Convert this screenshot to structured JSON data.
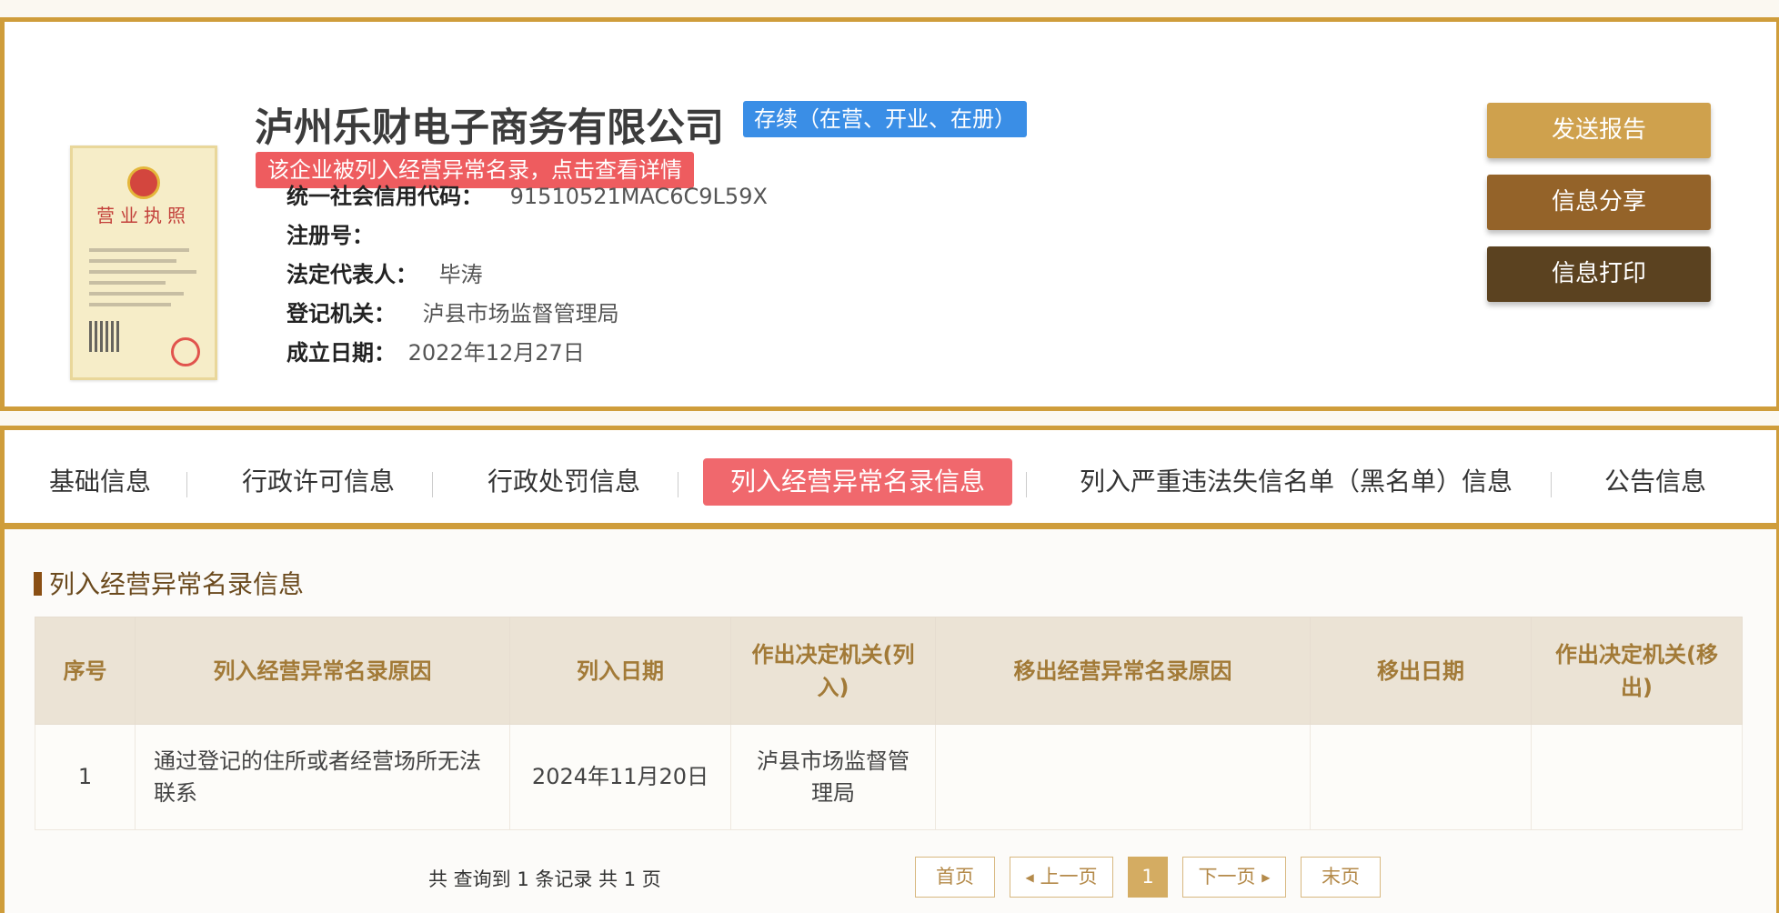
{
  "company": {
    "name": "泸州乐财电子商务有限公司",
    "status": "存续（在营、开业、在册）",
    "abnormal_notice": "该企业被列入经营异常名录，点击查看详情",
    "license_title": "营业执照",
    "fields": [
      {
        "label": "统一社会信用代码：",
        "value": "91510521MAC6C9L59X"
      },
      {
        "label": "注册号：",
        "value": ""
      },
      {
        "label": "法定代表人：",
        "value": "毕涛"
      },
      {
        "label": "登记机关：",
        "value": "泸县市场监督管理局"
      },
      {
        "label": "成立日期：",
        "value": "2022年12月27日"
      }
    ]
  },
  "actions": {
    "send_report": "发送报告",
    "share": "信息分享",
    "print": "信息打印"
  },
  "tabs": [
    {
      "label": "基础信息"
    },
    {
      "label": "行政许可信息"
    },
    {
      "label": "行政处罚信息"
    },
    {
      "label": "列入经营异常名录信息"
    },
    {
      "label": "列入严重违法失信名单（黑名单）信息"
    },
    {
      "label": "公告信息"
    }
  ],
  "section": {
    "title": "列入经营异常名录信息"
  },
  "table": {
    "headers": [
      "序号",
      "列入经营异常名录原因",
      "列入日期",
      "作出决定机关(列入)",
      "移出经营异常名录原因",
      "移出日期",
      "作出决定机关(移出)"
    ],
    "rows": [
      [
        "1",
        "通过登记的住所或者经营场所无法联系",
        "2024年11月20日",
        "泸县市场监督管理局",
        "",
        "",
        ""
      ]
    ]
  },
  "pagination": {
    "summary": "共 查询到 1 条记录 共 1 页",
    "first": "首页",
    "prev": "上一页",
    "current": "1",
    "next": "下一页",
    "last": "末页"
  },
  "colors": {
    "border_gold": "#cf9d3b",
    "status_blue": "#3a8ee6",
    "alert_red": "#ee5c5f",
    "active_tab": "#f0686d",
    "btn_send": "#cfa14d",
    "btn_share": "#946329",
    "btn_print": "#5b4220"
  }
}
